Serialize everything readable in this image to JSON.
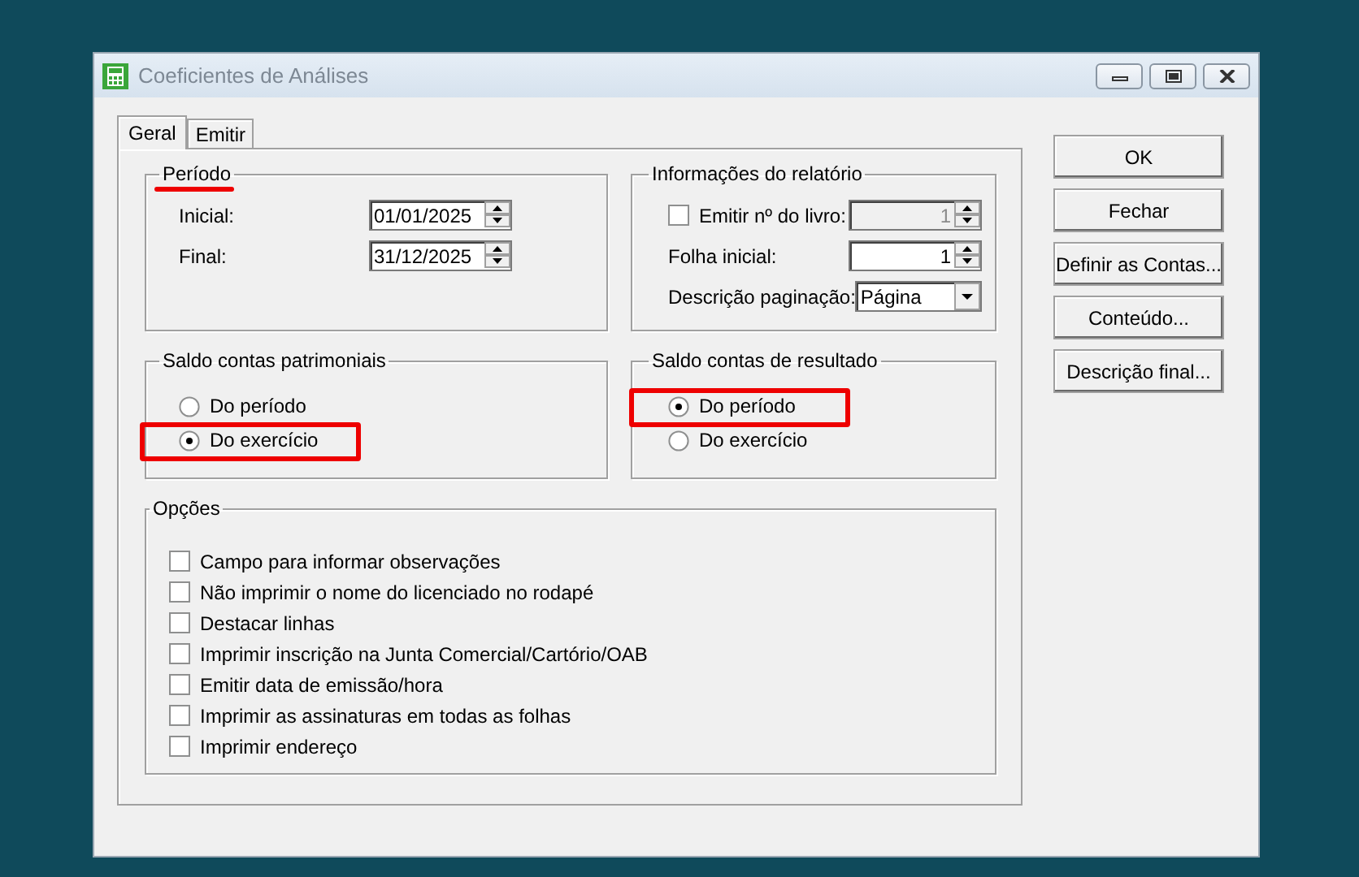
{
  "window": {
    "title": "Coeficientes de Análises"
  },
  "tabs": [
    {
      "label": "Geral",
      "selected": true
    },
    {
      "label": "Emitir",
      "selected": false
    }
  ],
  "periodo": {
    "title": "Período",
    "annotated": true,
    "fields": [
      {
        "label": "Inicial:",
        "value": "01/01/2025"
      },
      {
        "label": "Final:",
        "value": "31/12/2025"
      }
    ]
  },
  "report_info": {
    "title": "Informações do relatório",
    "rows": [
      {
        "kind": "check-spin",
        "label": "Emitir nº do livro:",
        "checked": false,
        "value": "1",
        "disabled": true
      },
      {
        "kind": "spin",
        "label": "Folha inicial:",
        "value": "1",
        "disabled": false
      },
      {
        "kind": "select",
        "label": "Descrição paginação:",
        "value": "Página"
      }
    ]
  },
  "saldo_patrimoniais": {
    "title": "Saldo contas patrimoniais",
    "options": [
      {
        "label": "Do período",
        "selected": false,
        "annotated": false
      },
      {
        "label": "Do exercício",
        "selected": true,
        "annotated": true
      }
    ]
  },
  "saldo_resultado": {
    "title": "Saldo contas de resultado",
    "options": [
      {
        "label": "Do período",
        "selected": true,
        "annotated": true
      },
      {
        "label": "Do exercício",
        "selected": false,
        "annotated": false
      }
    ]
  },
  "opcoes": {
    "title": "Opções",
    "items": [
      {
        "label": "Campo para informar observações",
        "checked": false
      },
      {
        "label": "Não imprimir o nome do licenciado no rodapé",
        "checked": false
      },
      {
        "label": "Destacar linhas",
        "checked": false
      },
      {
        "label": "Imprimir inscrição na Junta Comercial/Cartório/OAB",
        "checked": false
      },
      {
        "label": "Emitir data de emissão/hora",
        "checked": false
      },
      {
        "label": "Imprimir as assinaturas em todas as folhas",
        "checked": false
      },
      {
        "label": "Imprimir endereço",
        "checked": false
      }
    ]
  },
  "buttons": [
    "OK",
    "Fechar",
    "Definir as Contas...",
    "Conteúdo...",
    "Descrição final..."
  ]
}
